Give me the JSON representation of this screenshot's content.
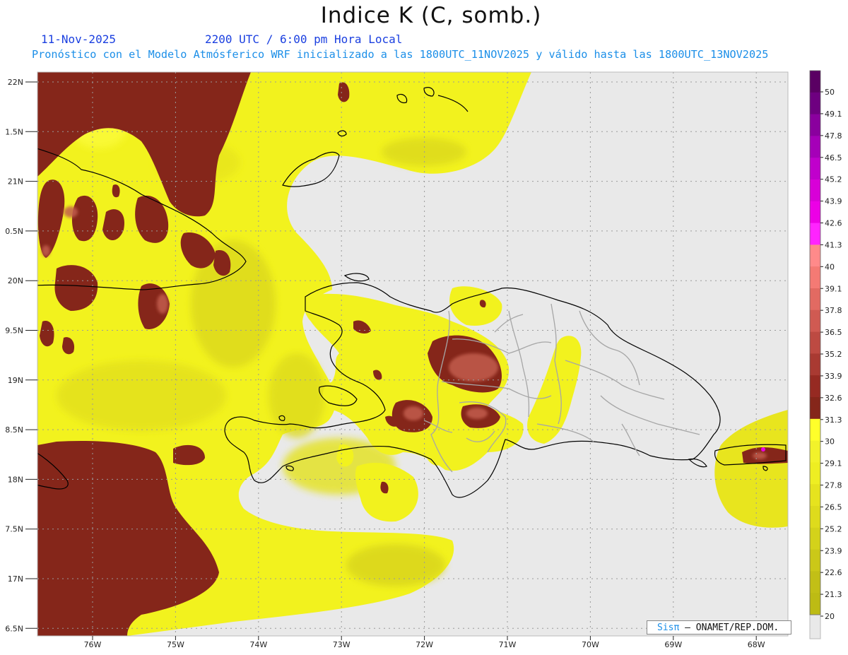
{
  "title": "Indice K (C, somb.)",
  "subtitle": {
    "date": "11-Nov-2025",
    "time": "2200 UTC / 6:00 pm Hora Local",
    "description": "Pronóstico con el Modelo Atmósferico WRF inicializado a las 1800UTC_11NOV2025 y válido hasta las  1800UTC_13NOV2025"
  },
  "credit": {
    "logo": "Sisπ",
    "text": "– ONAMET/REP.DOM."
  },
  "map_data": {
    "variable": "Indice K",
    "lon_range": [
      -76.65,
      -67.6
    ],
    "lat_range": [
      16.4,
      22.1
    ],
    "lat_ticks": [
      "22N",
      "1.5N",
      "21N",
      "0.5N",
      "20N",
      "9.5N",
      "19N",
      "8.5N",
      "18N",
      "7.5N",
      "17N",
      "6.5N"
    ],
    "lon_ticks": [
      "76W",
      "75W",
      "74W",
      "73W",
      "72W",
      "71W",
      "70W",
      "69W",
      "68W"
    ],
    "colorbar_labels": [
      "50",
      "49.1",
      "47.8",
      "46.5",
      "45.2",
      "43.9",
      "42.6",
      "41.3",
      "40",
      "39.1",
      "37.8",
      "36.5",
      "35.2",
      "33.9",
      "32.6",
      "31.3",
      "30",
      "29.1",
      "27.8",
      "26.5",
      "25.2",
      "23.9",
      "22.6",
      "21.3",
      "20"
    ],
    "colorbar_colors": [
      "#5a0063",
      "#6e0080",
      "#8a009e",
      "#a500b8",
      "#c000cc",
      "#d800d8",
      "#ec00e6",
      "#ff24ff",
      "#ff8a8a",
      "#f47a74",
      "#e26a62",
      "#d05a52",
      "#bd4a42",
      "#a93a32",
      "#962a22",
      "#85261a",
      "#ffff2a",
      "#f2f22a",
      "#eeee22",
      "#e6e31e",
      "#dedb1c",
      "#d4d21a",
      "#cbc818",
      "#c2bf16",
      "#bdbb14"
    ],
    "colors": {
      "background_land_sea": "#e9e9e9",
      "dominant": "#f2f21e",
      "high": "#85261a",
      "coast": "#000000",
      "border": "#a6a6a6"
    }
  }
}
